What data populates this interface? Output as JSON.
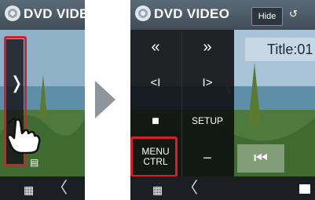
{
  "left_screen": {
    "app_title": "DVD VIDEO",
    "handle_arrow": "❭",
    "grid_icon": "▦",
    "back_chevron": "〈",
    "small_icon": "▤"
  },
  "right_screen": {
    "app_title": "DVD VIDEO",
    "hide_label": "Hide",
    "title_readout": "Title:01",
    "controls": {
      "rewind": "«",
      "fast_forward": "»",
      "slow_rewind": "<I",
      "slow_forward": "I>",
      "stop": "■",
      "setup": "SETUP",
      "menu_ctrl_line1": "MENU",
      "menu_ctrl_line2": "CTRL",
      "minus": "–"
    },
    "handle_arrow": "❬",
    "seek_icon": "⏮",
    "grid_icon": "▦",
    "back_chevron": "〈"
  },
  "colors": {
    "highlight": "#d4202a",
    "panel": "#0c0c0e",
    "arrow": "#8e959b"
  }
}
